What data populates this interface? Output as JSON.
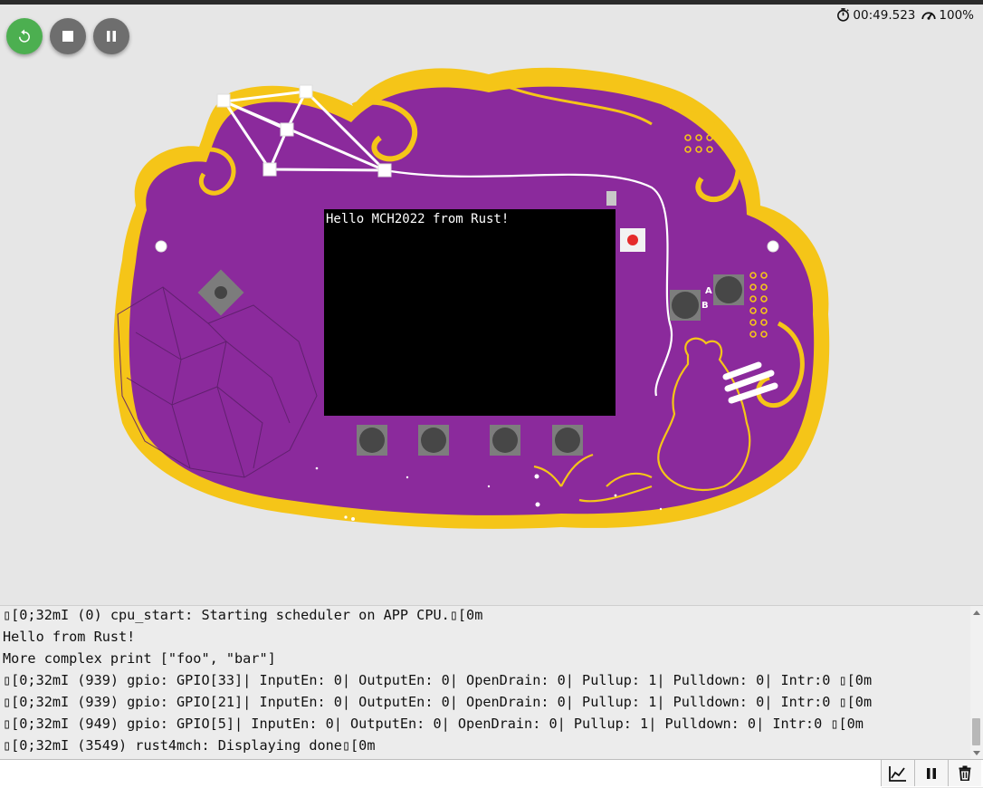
{
  "controls": {
    "restart_icon": "restart-icon",
    "stop_icon": "stop-icon",
    "pause_icon": "pause-icon"
  },
  "status": {
    "timer_icon": "stopwatch-icon",
    "time": "00:49.523",
    "speed_icon": "speedometer-icon",
    "speed": "100%"
  },
  "board": {
    "screen_text": "Hello MCH2022 from Rust!",
    "button_a_label": "A",
    "button_b_label": "B"
  },
  "console": {
    "lines": [
      "\u001b[0;32mI (0) cpu_start: Starting scheduler on APP CPU.\u001b[0m",
      "Hello from Rust!",
      "More complex print [\"foo\", \"bar\"]",
      "\u001b[0;32mI (939) gpio: GPIO[33]| InputEn: 0| OutputEn: 0| OpenDrain: 0| Pullup: 1| Pulldown: 0| Intr:0 \u001b[0m",
      "\u001b[0;32mI (939) gpio: GPIO[21]| InputEn: 0| OutputEn: 0| OpenDrain: 0| Pullup: 1| Pulldown: 0| Intr:0 \u001b[0m",
      "\u001b[0;32mI (949) gpio: GPIO[5]| InputEn: 0| OutputEn: 0| OpenDrain: 0| Pullup: 1| Pulldown: 0| Intr:0 \u001b[0m",
      "\u001b[0;32mI (3549) rust4mch: Displaying done\u001b[0m"
    ]
  },
  "toolbar": {
    "chart_icon": "chart-icon",
    "pause_icon": "pause-icon",
    "trash_icon": "trash-icon"
  },
  "colors": {
    "board_purple": "#8b2a9c",
    "board_gold": "#f5c518",
    "restart_green": "#4caf50",
    "button_grey": "#6e6e6e"
  }
}
